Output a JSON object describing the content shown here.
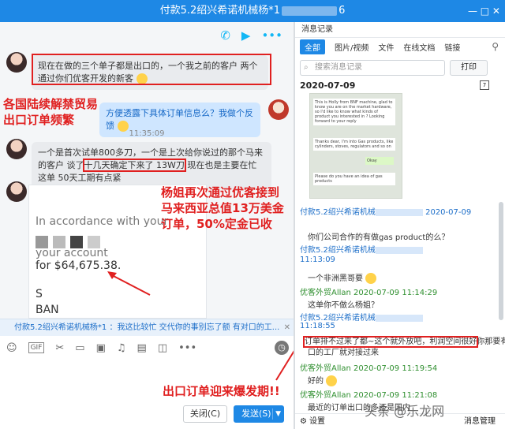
{
  "window": {
    "title_prefix": "付款5.2绍兴希诺机械杨*1",
    "title_suffix": "6",
    "controls": "—  □  ✕"
  },
  "chat": {
    "call_icons": [
      "phone-icon",
      "video-icon",
      "more-icon"
    ],
    "messages": [
      {
        "text": "现在在做的三个单子都是出口的，一个我之前的客户 两个通过你们优客开发的新客"
      },
      {
        "text": "方便透露下具体订单信息么？我做个反馈"
      },
      {
        "timestamp": "11:35:09"
      },
      {
        "text_a": "一个是首次试单800多刀，一个是上次给你说过的那个马来的客户 谈了",
        "highlight": "十几天确定下来了 13W刀",
        "text_b": "现在也是主要在忙这单 50天工期有点紧"
      }
    ],
    "doc": {
      "line1": "In accordance with your",
      "line2": "your account",
      "line3": "for $64,675.38.",
      "line4": "S",
      "line5": "BAN"
    },
    "annotations": {
      "left": "各国陆续解禁贸易\n出口订单频繁",
      "right": "杨姐再次通过优客接到\n马来西亚总值13万美金\n订单，50%定金已收",
      "bottom": "出口订单迎来爆发期!!"
    },
    "notify": "付款5.2绍兴希诺机械杨*1          ：我这比较忙 交代你的事别忘了额 有对口的工...",
    "buttons": {
      "close": "关闭(C)",
      "send": "发送(S)"
    }
  },
  "history": {
    "header": "消息记录",
    "tabs": [
      "全部",
      "图片/视频",
      "文件",
      "在线文档",
      "链接"
    ],
    "search_placeholder": "搜索消息记录",
    "print": "打印",
    "date": "2020-07-09",
    "calendar": "7",
    "screenshot": {
      "b1": "This is Holly from BNF machine, glad to know you are on the market hardware, so I'd like to know what kinds of product you interested in ? Looking forward to your reply",
      "b2": "Thanks dear, I'm into Gas products, like cylinders, stoves, regulators and so on",
      "b3": "Okay",
      "b4": "Please do you have an idea of gas products"
    },
    "entries": [
      {
        "meta_a": "付款5.2绍兴希诺机械",
        "meta_b": "2020-07-09"
      },
      {
        "msg": "你们公司合作的有做gas product的么？"
      },
      {
        "meta": "付款5.2绍兴希诺机械",
        "time": "11:13:09"
      },
      {
        "msg": "一个非洲黑哥要"
      },
      {
        "meta": "优客外贸Allan 2020-07-09 11:14:29"
      },
      {
        "msg": "这单你不做么杨姐？"
      },
      {
        "meta": "付款5.2绍兴希诺机械",
        "time": "11:18:55"
      },
      {
        "msg_a": "订单排不过来了都~这个就外放吧，利润空间很好",
        "msg_b": "你那要有对",
        "msg_c": "口的工厂就对接过来"
      },
      {
        "meta": "优客外贸Allan 2020-07-09 11:19:54"
      },
      {
        "msg": "好的"
      },
      {
        "meta": "优客外贸Allan 2020-07-09 11:21:08"
      },
      {
        "msg": "最近的订单出口的多还是国内"
      }
    ],
    "footer": {
      "settings": "设置",
      "manager": "消息管理"
    }
  },
  "watermark": "头条 @乐龙网"
}
